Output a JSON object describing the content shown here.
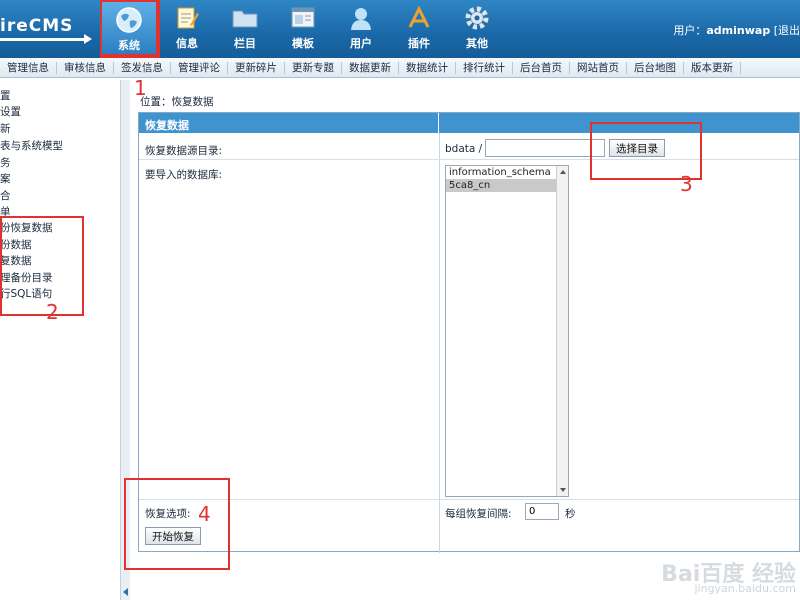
{
  "header": {
    "logo": "ireCMS",
    "nav": [
      {
        "label": "系统",
        "icon": "globe-icon"
      },
      {
        "label": "信息",
        "icon": "notepad-icon"
      },
      {
        "label": "栏目",
        "icon": "folder-icon"
      },
      {
        "label": "模板",
        "icon": "template-icon"
      },
      {
        "label": "用户",
        "icon": "user-icon"
      },
      {
        "label": "插件",
        "icon": "tools-icon"
      },
      {
        "label": "其他",
        "icon": "gear-icon"
      }
    ],
    "user_prefix": "用户：",
    "username": "adminwap",
    "logout": "[退出"
  },
  "submenu": [
    "管理信息",
    "审核信息",
    "签发信息",
    "管理评论",
    "更新碎片",
    "更新专题",
    "数据更新",
    "数据统计",
    "排行统计",
    "后台首页",
    "网站首页",
    "后台地图",
    "版本更新"
  ],
  "sidebar": {
    "items": [
      "置",
      "设置",
      "新",
      "表与系统模型",
      "务",
      "案",
      "合",
      "单",
      "份恢复数据",
      "份数据",
      "复数据",
      "理备份目录",
      "行SQL语句"
    ]
  },
  "breadcrumb": "位置：恢复数据",
  "panel": {
    "title": "恢复数据",
    "dir_label": "恢复数据源目录:",
    "dir_prefix": "bdata /",
    "dir_value": "",
    "choose_dir_button": "选择目录",
    "db_label": "要导入的数据库:",
    "databases": [
      "information_schema",
      "5ca8_cn"
    ],
    "selected_db": "5ca8_cn",
    "options_label": "恢复选项:",
    "interval_label": "每组恢复间隔:",
    "interval_value": "0",
    "interval_unit": "秒",
    "start_button": "开始恢复"
  },
  "annotations": [
    "1",
    "2",
    "3",
    "4"
  ],
  "watermark": {
    "big": "Bai百度 经验",
    "small": "jingyan.baidu.com"
  },
  "colors": {
    "header": "#1a68a8",
    "panel_head": "#3f93cf",
    "annotation": "#e0322f"
  }
}
